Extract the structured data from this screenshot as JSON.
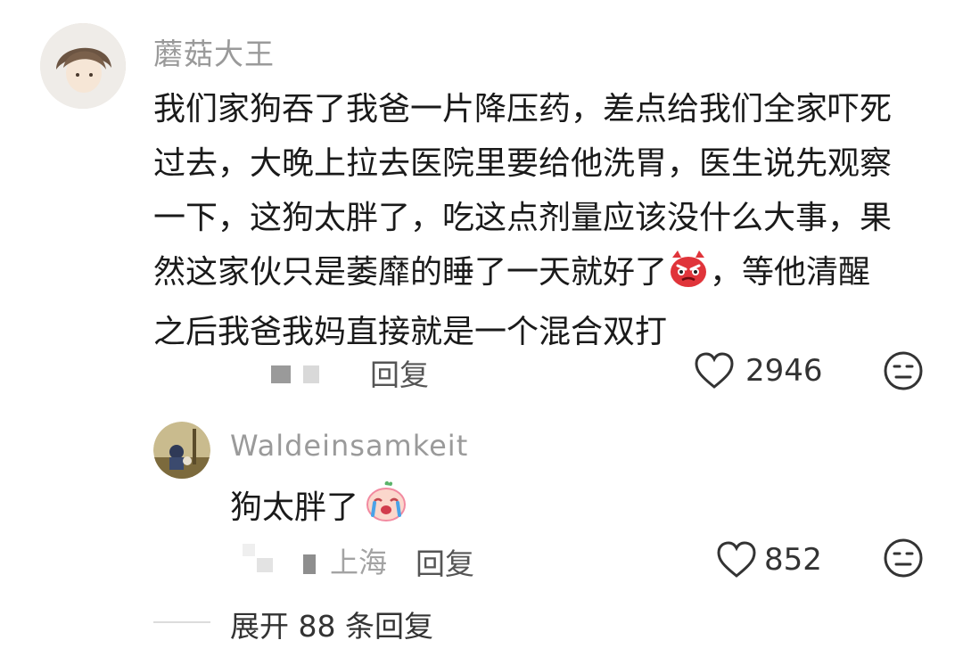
{
  "comment": {
    "username": "蘑菇大王",
    "lines": [
      "我们家狗吞了我爸一片降压药，差点给我们全家吓死",
      "过去，大晚上拉去医院里要给他洗胃，医生说先观察",
      "一下，这狗太胖了，吃这点剂量应该没什么大事，果",
      "然这家伙只是萎靡的睡了一天就好了",
      "，等他清醒",
      "之后我爸我妈直接就是一个混合双打"
    ],
    "reply_label": "回复",
    "like_count": "2946"
  },
  "reply": {
    "username": "Waldeinsamkeit",
    "text": "狗太胖了",
    "location": "上海",
    "reply_label": "回复",
    "like_count": "852"
  },
  "expand": {
    "label": "展开 88 条回复"
  },
  "icons": {
    "heart": "heart-icon",
    "emoji_react": "neutral-face-icon",
    "angry": "angry-face-emoji",
    "crying": "crying-face-emoji"
  },
  "colors": {
    "username": "#9a9a9a",
    "text": "#1a1a1a",
    "angry_red": "#e0343a",
    "crying_pink": "#f28aa0"
  }
}
